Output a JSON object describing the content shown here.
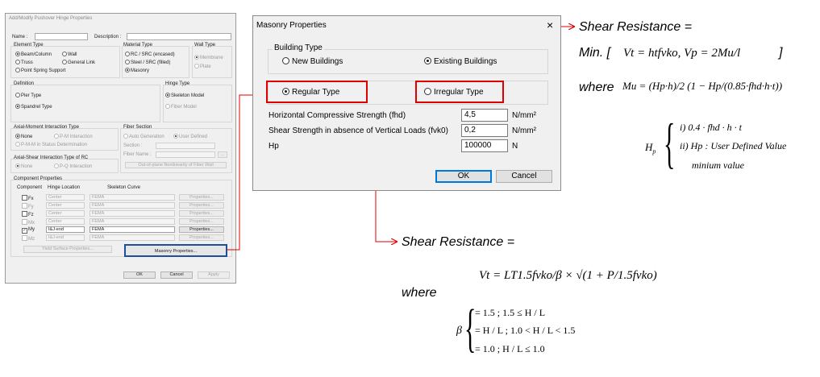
{
  "hinge_dialog": {
    "title": "Add/Modify Pushover Hinge Properties",
    "name_label": "Name :",
    "description_label": "Description :",
    "element_type": {
      "title": "Element Type",
      "beam_column": "Beam/Column",
      "wall": "Wall",
      "truss": "Truss",
      "general_link": "General Link",
      "point_spring": "Point Spring Support"
    },
    "material_type": {
      "title": "Material Type",
      "rc_src_encased": "RC / SRC (encased)",
      "steel_src_filled": "Steel / SRC (filled)",
      "masonry": "Masonry"
    },
    "wall_type": {
      "title": "Wall Type",
      "membrane": "Membrane",
      "plate": "Plate"
    },
    "definition": {
      "title": "Definition",
      "pier_type": "Pier Type",
      "spandrel_type": "Spandrel Type"
    },
    "hinge_type": {
      "title": "Hinge Type",
      "skeleton_model": "Skeleton Model",
      "fiber_model": "Fiber Model"
    },
    "axial_moment": {
      "title": "Axial-Moment Interaction Type",
      "none": "None",
      "pm": "P-M Interaction",
      "pmm": "P-M-M in Status Determination"
    },
    "fiber_section": {
      "title": "Fiber Section",
      "auto_generation": "Auto Generation",
      "user_defined": "User Defined",
      "section_label": "Section :",
      "fiber_name_label": "Fiber Name :",
      "ellipsis": "...",
      "out_of_plane_button": "Out-of-plane Nonlinearity of Fiber Wall"
    },
    "axial_shear": {
      "title": "Axial-Shear Interaction Type of RC",
      "none": "None",
      "pq": "P-Q Interaction"
    },
    "component_properties": {
      "title": "Component Properties",
      "col_component": "Component",
      "col_hinge_location": "Hinge Location",
      "col_skeleton_curve": "Skeleton Curve",
      "rows": [
        {
          "name": "Fx",
          "location": "Center",
          "curve": "FEMA",
          "button": "Properties...",
          "checked": false,
          "enabled": true
        },
        {
          "name": "Fy",
          "location": "Center",
          "curve": "FEMA",
          "button": "Properties...",
          "checked": false,
          "enabled": false
        },
        {
          "name": "Fz",
          "location": "Center",
          "curve": "FEMA",
          "button": "Properties...",
          "checked": false,
          "enabled": true
        },
        {
          "name": "Mx",
          "location": "Center",
          "curve": "FEMA",
          "button": "Properties...",
          "checked": false,
          "enabled": false
        },
        {
          "name": "My",
          "location": "I&J-end",
          "curve": "FEMA",
          "button": "Properties...",
          "checked": true,
          "enabled": true
        },
        {
          "name": "Mz",
          "location": "I&J-end",
          "curve": "FEMA",
          "button": "Properties...",
          "checked": false,
          "enabled": false
        }
      ],
      "yield_surface_button": "Yield Surface Properties...",
      "masonry_button": "Masonry Properties..."
    },
    "ok_button": "OK",
    "cancel_button": "Cancel",
    "apply_button": "Apply"
  },
  "masonry_dialog": {
    "title": "Masonry Properties",
    "close_glyph": "×",
    "building_type_title": "Building Type",
    "new_buildings": "New Buildings",
    "existing_buildings": "Existing Buildings",
    "regular_type": "Regular Type",
    "irregular_type": "Irregular Type",
    "fields": [
      {
        "label": "Horizontal Compressive Strength (fhd)",
        "value": "4,5",
        "unit": "N/mm²"
      },
      {
        "label": "Shear Strength in absence of Vertical Loads (fvk0)",
        "value": "0,2",
        "unit": "N/mm²"
      },
      {
        "label": "Hp",
        "value": "100000",
        "unit": "N"
      }
    ],
    "ok_button": "OK",
    "cancel_button": "Cancel"
  },
  "annotations": {
    "shear_resistance_label": "Shear Resistance =",
    "regular": {
      "min_prefix": "Min. [",
      "vt_formula": "Vt = htfvko, Vp = 2Mu/l",
      "close_bracket": "]",
      "where": "where",
      "mu_formula": "Mu = (Hp·h)/2 (1 − Hp/(0.85·fhd·h·t))",
      "hp_case_1": "i) 0.4 · fhd · h · t",
      "hp_case_2": "ii) Hp : User Defined Value",
      "hp_case_3": "minium value"
    },
    "irregular": {
      "vt_formula": "Vt = LT1.5fvko/β × √(1 + P/1.5fvko)",
      "where": "where",
      "beta_case_1": "= 1.5 ; 1.5 ≤ H / L",
      "beta_case_2": "= H / L ;  1.0 < H / L < 1.5",
      "beta_case_3": "= 1.0 ;  H / L ≤ 1.0"
    }
  },
  "colors": {
    "highlight_red": "#e00000",
    "button_blue": "#1f4e9c",
    "default_button": "#0078d7"
  }
}
